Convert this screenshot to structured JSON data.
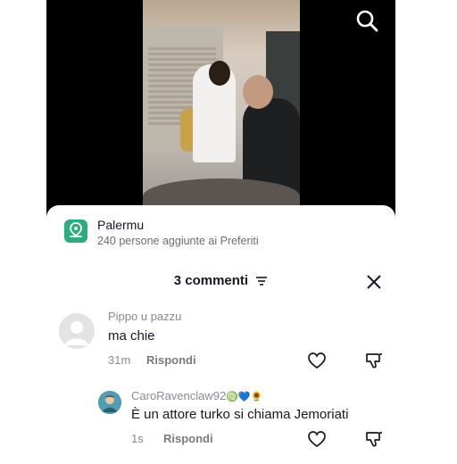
{
  "location": {
    "name": "Palermu",
    "subtitle": "240 persone aggiunte ai Preferiti"
  },
  "comments_panel": {
    "title": "3 commenti"
  },
  "comments": [
    {
      "username": "Pippo u pazzu",
      "text": "ma chie",
      "time": "31m",
      "reply_label": "Rispondi"
    },
    {
      "username": "CaroRavenclaw92",
      "username_emojis": "♍💙🌻",
      "text": "È un attore turko si chiama Jemoriati",
      "time": "1s",
      "reply_label": "Rispondi"
    }
  ],
  "colors": {
    "location_badge": "#2aae7b",
    "text_primary": "#161823",
    "text_secondary": "#8a8b91"
  }
}
